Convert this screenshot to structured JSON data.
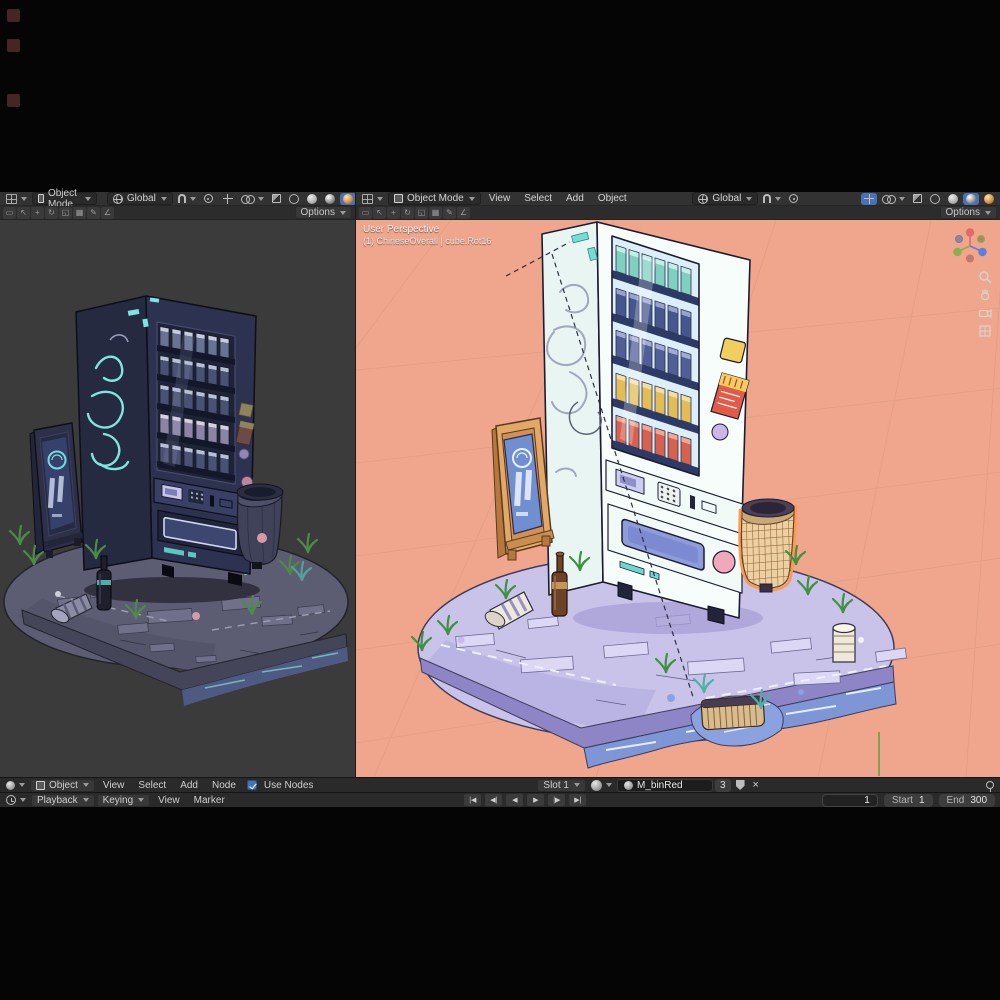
{
  "left_viewport": {
    "header": {
      "mode": "Object Mode",
      "orientation": "Global",
      "options_label": "Options"
    }
  },
  "right_viewport": {
    "header": {
      "mode": "Object Mode",
      "menus": {
        "view": "View",
        "select": "Select",
        "add": "Add",
        "object": "Object"
      },
      "orientation": "Global",
      "options_label": "Options"
    },
    "overlay": {
      "view_name": "User Perspective",
      "active_object": "(1) ChineseOverall | cube.Rot16"
    }
  },
  "shader_editor": {
    "mode": "Object",
    "menus": {
      "view": "View",
      "select": "Select",
      "add": "Add",
      "node": "Node"
    },
    "use_nodes_label": "Use Nodes",
    "slot_label": "Slot 1",
    "material_name": "M_binRed",
    "user_count": "3"
  },
  "timeline": {
    "menus": {
      "playback": "Playback",
      "keying": "Keying",
      "view": "View",
      "marker": "Marker"
    },
    "transport": [
      "|◀",
      "◀|",
      "◀",
      "▶",
      "|▶",
      "▶|"
    ],
    "current_frame": "1",
    "start_label": "Start",
    "start_value": "1",
    "end_label": "End",
    "end_value": "300"
  },
  "viewport_tools": {
    "glyphs": [
      "▭",
      "↖",
      "+",
      "↻",
      "◱",
      "▦",
      "✎",
      "∠"
    ]
  },
  "glyphs": {
    "close": "×"
  },
  "icons": {
    "editor-3d-viewport": "grid",
    "editor-shader": "sphere",
    "editor-timeline": "clock",
    "snap": "magnet",
    "orientation": "globe",
    "proportional-editing": "dot-circle",
    "shading-wireframe": "circle-outline",
    "shading-solid": "gray-sphere",
    "shading-material": "shiny-sphere",
    "shading-rendered": "lit-sphere",
    "navigation": "axis-ball",
    "zoom": "magnifier",
    "pan": "hand",
    "camera-view": "camera",
    "ortho-toggle": "grid",
    "pin": "pin",
    "fake-user": "shield",
    "unlink": "x"
  },
  "colors": {
    "accent": "#4772b3",
    "header_bg": "#323232",
    "viewport_left_bg": "#3b3b3b",
    "viewport_right_bg": "#f0a68c",
    "outline": "#1c1c30"
  }
}
